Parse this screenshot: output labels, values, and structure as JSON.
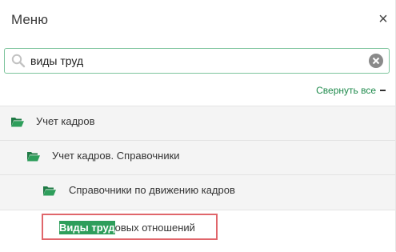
{
  "header": {
    "title": "Меню",
    "close_symbol": "×"
  },
  "search": {
    "value": "виды труд",
    "placeholder": ""
  },
  "collapse_all": {
    "label": "Свернуть все"
  },
  "tree": [
    {
      "label": "Учет кадров",
      "icon": "folder-open-icon"
    },
    {
      "label": "Учет кадров. Справочники",
      "icon": "folder-open-icon"
    },
    {
      "label": "Справочники по движению кадров",
      "icon": "folder-open-icon"
    }
  ],
  "result": {
    "highlight": "Виды труд",
    "rest": "овых отношений"
  },
  "colors": {
    "accent": "#1f8a4c",
    "highlight_bg": "#2e9e5b",
    "selection_border": "#e0666b",
    "search_border": "#7cc49b"
  }
}
